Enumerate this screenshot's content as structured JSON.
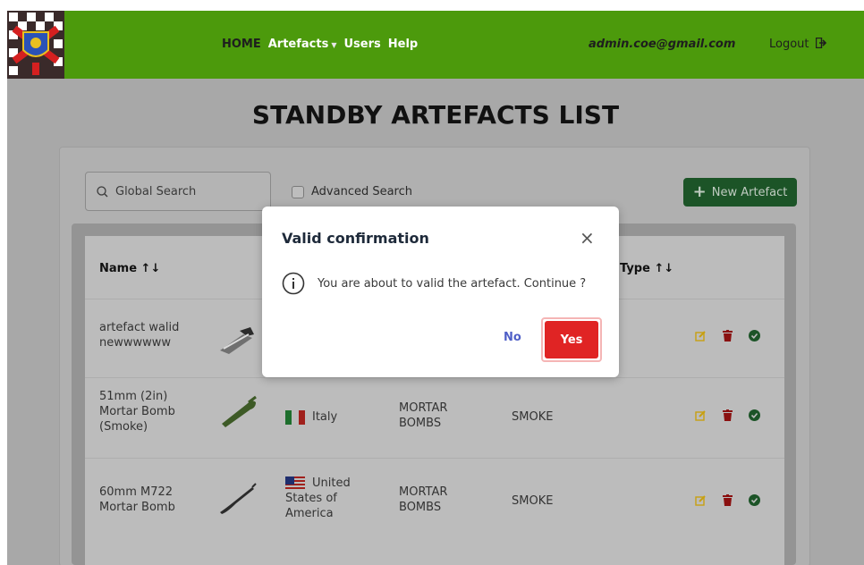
{
  "navbar": {
    "links": [
      {
        "label": "HOME"
      },
      {
        "label": "Artefacts"
      },
      {
        "label": "Users"
      },
      {
        "label": "Help"
      }
    ],
    "user_email": "admin.coe@gmail.com",
    "logout_label": "Logout",
    "bg_color": "#4c9a0c"
  },
  "page": {
    "title": "STANDBY ARTEFACTS LIST"
  },
  "toolbar": {
    "search_placeholder": "Global Search",
    "advanced_search_label": "Advanced Search",
    "new_artefact_label": "New Artefact"
  },
  "table": {
    "headers": {
      "name": "Name",
      "type": "Type"
    },
    "rows": [
      {
        "name": "artefact walid newwwwww",
        "country": "",
        "category": "",
        "type": ""
      },
      {
        "name": "51mm (2in) Mortar Bomb (Smoke)",
        "country": "Italy",
        "category": "MORTAR BOMBS",
        "type": "SMOKE"
      },
      {
        "name": "60mm M722 Mortar Bomb",
        "country": "United States of America",
        "category": "MORTAR BOMBS",
        "type": "SMOKE"
      }
    ]
  },
  "modal": {
    "title": "Valid confirmation",
    "message": "You are about to valid the artefact. Continue ?",
    "no_label": "No",
    "yes_label": "Yes",
    "yes_color": "#e02424"
  }
}
